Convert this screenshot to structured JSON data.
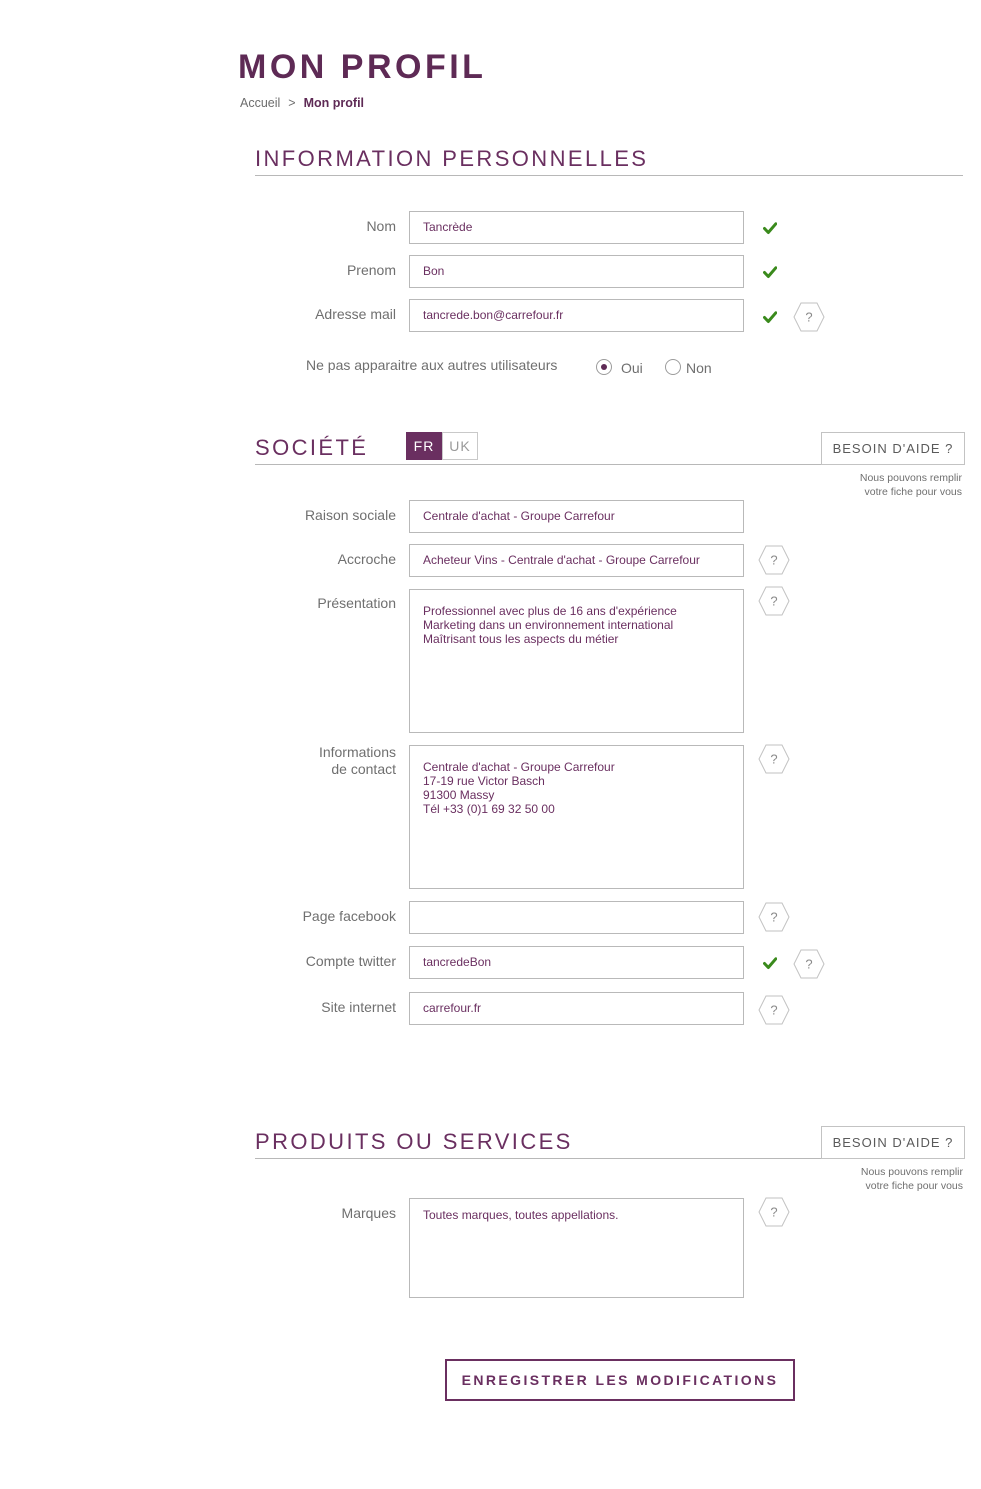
{
  "page": {
    "title": "MON PROFIL"
  },
  "breadcrumb": {
    "home": "Accueil",
    "separator": ">",
    "current": "Mon profil"
  },
  "colors": {
    "brand": "#6a2f60",
    "success": "#3a8a1c",
    "border": "#b9b9b9"
  },
  "personal": {
    "title": "INFORMATION PERSONNELLES",
    "fields": [
      {
        "label": "Nom",
        "value": "Tancrède",
        "valid": true
      },
      {
        "label": "Prenom",
        "value": "Bon",
        "valid": true
      },
      {
        "label": "Adresse mail",
        "value": "tancrede.bon@carrefour.fr",
        "valid": true,
        "help": "?"
      }
    ],
    "visibility": {
      "label": "Ne pas apparaitre aux autres utilisateurs",
      "options": [
        {
          "label": "Oui",
          "selected": true
        },
        {
          "label": "Non",
          "selected": false
        }
      ]
    }
  },
  "company": {
    "title": "SOCIÉTÉ",
    "languages": [
      {
        "label": "FR",
        "active": true
      },
      {
        "label": "UK",
        "active": false
      }
    ],
    "help_button": "BESOIN D'AIDE ?",
    "help_note": "Nous pouvons remplir\nvotre fiche pour vous",
    "fields": [
      {
        "label": "Raison sociale",
        "value": "Centrale d'achat - Groupe Carrefour"
      },
      {
        "label": "Accroche",
        "value": "Acheteur Vins - Centrale d'achat - Groupe Carrefour",
        "help": "?"
      },
      {
        "label": "Présentation",
        "value": "Professionnel avec plus de 16 ans d'expérience\nMarketing dans un environnement international\nMaîtrisant tous les aspects du métier",
        "help": "?"
      },
      {
        "label": "Informations\nde contact",
        "value": "Centrale d'achat - Groupe Carrefour\n17-19 rue Victor Basch\n91300 Massy\nTél +33 (0)1 69 32 50 00",
        "help": "?"
      },
      {
        "label": "Page facebook",
        "value": "",
        "help": "?"
      },
      {
        "label": "Compte twitter",
        "value": "tancredeBon",
        "valid": true,
        "help": "?"
      },
      {
        "label": "Site internet",
        "value": "carrefour.fr",
        "help": "?"
      }
    ]
  },
  "products": {
    "title": "PRODUITS OU SERVICES",
    "help_button": "BESOIN D'AIDE ?",
    "help_note": "Nous pouvons remplir\nvotre fiche pour vous",
    "fields": [
      {
        "label": "Marques",
        "value": "Toutes marques, toutes appellations.",
        "help": "?"
      }
    ]
  },
  "actions": {
    "save": "ENREGISTRER LES MODIFICATIONS"
  }
}
